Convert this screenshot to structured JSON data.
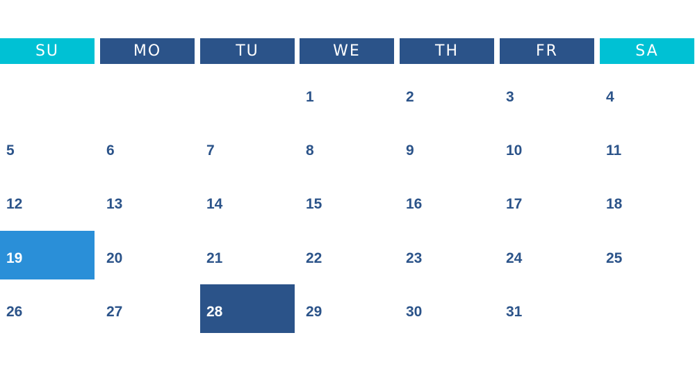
{
  "weekdays": [
    "SU",
    "MO",
    "TU",
    "WE",
    "TH",
    "FR",
    "SA"
  ],
  "weekend_indices": [
    0,
    6
  ],
  "weeks": [
    [
      "",
      "",
      "",
      "1",
      "2",
      "3",
      "4"
    ],
    [
      "5",
      "6",
      "7",
      "8",
      "9",
      "10",
      "11"
    ],
    [
      "12",
      "13",
      "14",
      "15",
      "16",
      "17",
      "18"
    ],
    [
      "19",
      "20",
      "21",
      "22",
      "23",
      "24",
      "25"
    ],
    [
      "26",
      "27",
      "28",
      "29",
      "30",
      "31",
      ""
    ]
  ],
  "highlighted_day": "19",
  "selected_day": "28",
  "colors": {
    "weekend_header": "#00c1d4",
    "weekday_header": "#2b5389",
    "date_text": "#2b5389",
    "highlight_bg": "#2a8fd8",
    "selected_bg": "#2b5389"
  }
}
